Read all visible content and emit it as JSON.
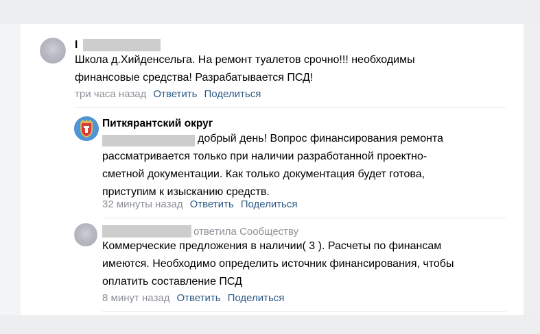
{
  "colors": {
    "link": "#2a5885",
    "meta": "#8b8f97",
    "background": "#edeef0",
    "card": "#ffffff",
    "crest_blue": "#4f94d4",
    "crest_red": "#d93b35",
    "crest_gold": "#f2c744"
  },
  "comments": [
    {
      "author_redacted": true,
      "author_initial": "I",
      "text": "Школа д.Хийденсельга. На ремонт туалетов срочно!!! необходимы\nфинансовые средства! Разрабатывается ПСД!",
      "time": "три часа назад",
      "reply": "Ответить",
      "share": "Поделиться"
    },
    {
      "author": "Питкярантский округ",
      "avatar_icon": "coat-of-arms-icon",
      "text": "добрый день! Вопрос финансирования ремонта\nрассматривается только при наличии разработанной проектно-\nсметной документации. Как только документация будет готова,\nприступим к изысканию средств.",
      "time": "32 минуты назад",
      "reply": "Ответить",
      "share": "Поделиться"
    },
    {
      "author_redacted": true,
      "replied_to": "ответила Сообществу",
      "text": "Коммерческие предложения в наличии( 3 ). Расчеты по финансам\nимеются. Необходимо определить источник финансирования, чтобы\nоплатить составление ПСД",
      "time": "8 минут назад",
      "reply": "Ответить",
      "share": "Поделиться"
    }
  ]
}
